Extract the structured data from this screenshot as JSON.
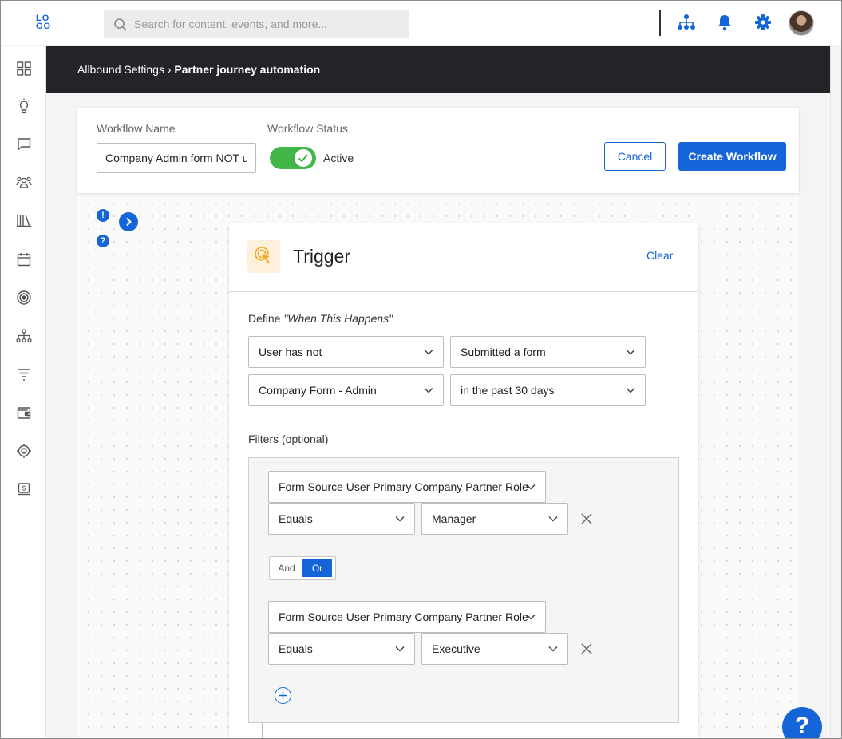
{
  "topbar": {
    "logo_text": "LOGO",
    "search_placeholder": "Search for content, events, and more...",
    "icons": [
      "org-chart-icon",
      "bell-icon",
      "gear-icon"
    ],
    "accent_color": "#1565d8"
  },
  "sidebar": {
    "items": [
      "dashboard-icon",
      "lightbulb-icon",
      "chat-icon",
      "users-icon",
      "library-icon",
      "calendar-icon",
      "target-icon",
      "hierarchy-icon",
      "filter-icon",
      "wallet-icon",
      "integration-icon",
      "billing-icon"
    ]
  },
  "breadcrumb": {
    "parent": "Allbound Settings",
    "separator": "›",
    "current": "Partner journey automation"
  },
  "workflow": {
    "name_label": "Workflow Name",
    "name_value": "Company Admin form NOT updated",
    "status_label": "Workflow Status",
    "status_value": "Active",
    "status_on": true,
    "cancel_label": "Cancel",
    "create_label": "Create Workflow"
  },
  "trigger": {
    "title": "Trigger",
    "clear_label": "Clear",
    "define_prefix": "Define",
    "define_quote": "\"When This Happens\"",
    "row1": [
      "User has not",
      "Submitted a form"
    ],
    "row2": [
      "Company Form - Admin",
      "in the past 30 days"
    ],
    "filters_label": "Filters (optional)",
    "filters": [
      {
        "field": "Form Source User Primary Company Partner Role",
        "operator": "Equals",
        "value": "Manager"
      },
      {
        "field": "Form Source User Primary Company Partner Role",
        "operator": "Equals",
        "value": "Executive"
      }
    ],
    "logic": {
      "and_label": "And",
      "or_label": "Or",
      "selected": "Or"
    }
  },
  "help_fab_label": "?"
}
